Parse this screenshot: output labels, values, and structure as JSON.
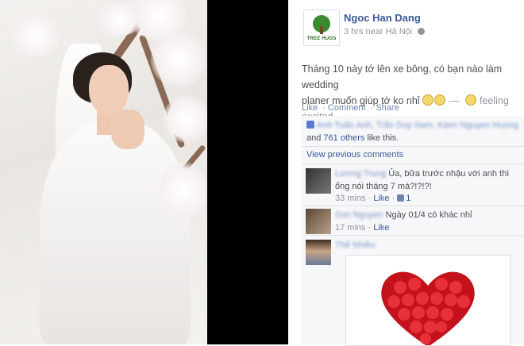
{
  "post": {
    "author": "Ngoc Han Dang",
    "avatar_brand": "TREE HUGS",
    "time_location": "3 hrs near Hà Nội",
    "message_line1": "Tháng 10 này tớ lên xe bông, có bạn nào làm wedding",
    "message_line2": "planer muốn giúp tớ ko nhỉ",
    "feeling": "— feeling excited",
    "actions": [
      "Like",
      "Comment",
      "Share"
    ]
  },
  "likes": {
    "names_blurred": "Anh Tuấn Anh, Trần Duy Nam, Kiem Nguyen Huong",
    "and_text": "and",
    "others": "761 others",
    "like_this": "like this."
  },
  "view_previous": "View previous comments",
  "comments": [
    {
      "author_blurred": "Lương Trung",
      "text": "Ủa, bữa trước nhậu với anh thì ổng nói tháng 7 mà?!?!?!",
      "time": "33 mins",
      "like": "Like",
      "like_count": "1"
    },
    {
      "author_blurred": "Son Nguyen",
      "text": "Ngày 01/4 có khác nhỉ",
      "time": "17 mins",
      "like": "Like"
    },
    {
      "author_blurred": "Thế Nhiều"
    }
  ],
  "colors": {
    "link": "#3b5998",
    "feedback_bg": "#f6f7f9",
    "rose": "#d01820"
  }
}
